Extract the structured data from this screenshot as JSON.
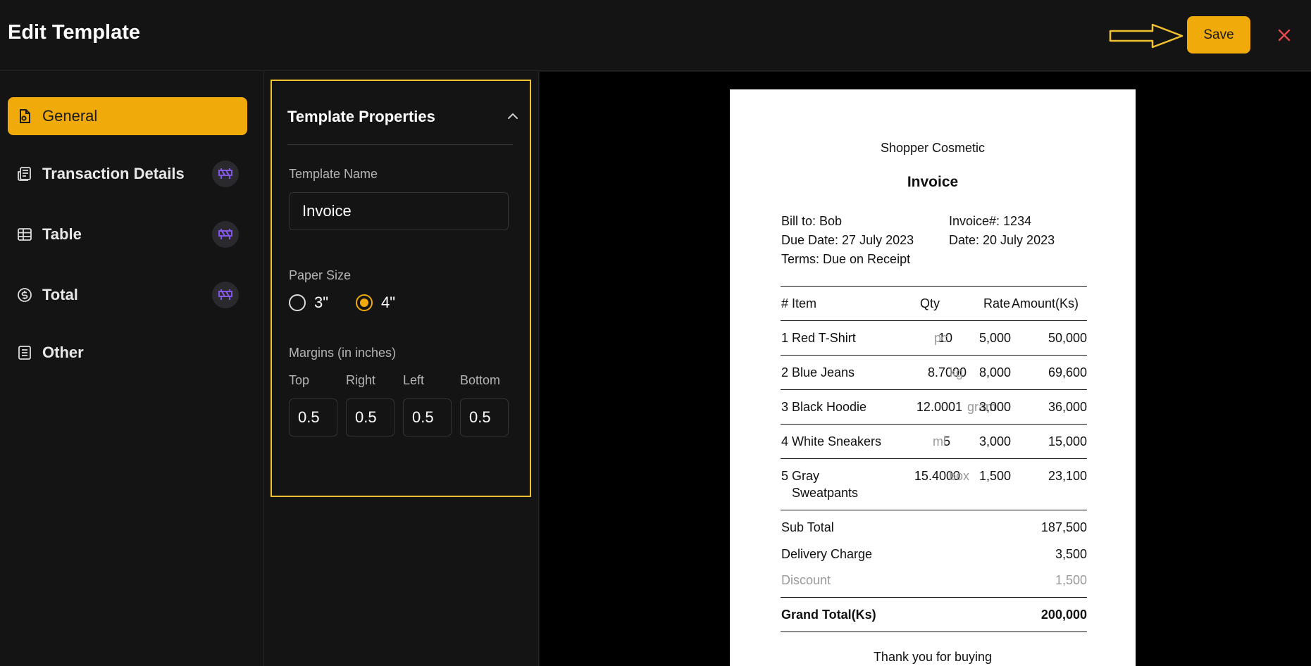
{
  "header": {
    "title": "Edit Template",
    "save_label": "Save"
  },
  "sidebar": {
    "items": [
      {
        "label": "General",
        "icon": "file-settings-icon",
        "active": true
      },
      {
        "label": "Transaction Details",
        "icon": "receipt-icon",
        "badge": "under-construction-icon"
      },
      {
        "label": "Table",
        "icon": "table-icon",
        "badge": "under-construction-icon"
      },
      {
        "label": "Total",
        "icon": "dollar-circle-icon",
        "badge": "under-construction-icon"
      },
      {
        "label": "Other",
        "icon": "document-lines-icon"
      }
    ]
  },
  "properties": {
    "title": "Template Properties",
    "template_name_label": "Template Name",
    "template_name_value": "Invoice",
    "paper_size_label": "Paper Size",
    "paper_options": [
      "3\"",
      "4\""
    ],
    "paper_selected": "4\"",
    "margins_label": "Margins (in inches)",
    "margins": [
      {
        "label": "Top",
        "value": "0.5"
      },
      {
        "label": "Right",
        "value": "0.5"
      },
      {
        "label": "Left",
        "value": "0.5"
      },
      {
        "label": "Bottom",
        "value": "0.5"
      }
    ]
  },
  "preview": {
    "shop_name": "Shopper Cosmetic",
    "doc_title": "Invoice",
    "bill_to": "Bill to: Bob",
    "due_date": "Due Date: 27 July 2023",
    "terms": "Terms: Due on Receipt",
    "invoice_no": "Invoice#: 1234",
    "date": "Date: 20 July 2023",
    "columns": {
      "no": "#",
      "item": "Item",
      "qty": "Qty",
      "rate": "Rate",
      "amount": "Amount(Ks)"
    },
    "rows": [
      {
        "no": "1",
        "item": "Red T-Shirt",
        "item2": "",
        "qty": "10",
        "unit": "pc",
        "rate": "5,000",
        "amount": "50,000"
      },
      {
        "no": "2",
        "item": "Blue Jeans",
        "item2": "",
        "qty": "8.7000",
        "unit": "kg",
        "rate": "8,000",
        "amount": "69,600"
      },
      {
        "no": "3",
        "item": "Black Hoodie",
        "item2": "",
        "qty": "12.0001",
        "unit": "gram",
        "rate": "3,000",
        "amount": "36,000"
      },
      {
        "no": "4",
        "item": "White Sneakers",
        "item2": "",
        "qty": "5",
        "unit": "ml",
        "rate": "3,000",
        "amount": "15,000"
      },
      {
        "no": "5",
        "item": "Gray",
        "item2": "Sweatpants",
        "qty": "15.4000",
        "unit": "box",
        "rate": "1,500",
        "amount": "23,100"
      }
    ],
    "sub_total_label": "Sub Total",
    "sub_total": "187,500",
    "delivery_label": "Delivery Charge",
    "delivery": "3,500",
    "discount_label": "Discount",
    "discount": "1,500",
    "grand_total_label": "Grand Total(Ks)",
    "grand_total": "200,000",
    "footer": "Thank you for buying"
  },
  "colors": {
    "accent": "#f0ab0a",
    "highlight_border": "#f2c12e",
    "close": "#e5484d",
    "badge_icon": "#8b5cf6"
  }
}
